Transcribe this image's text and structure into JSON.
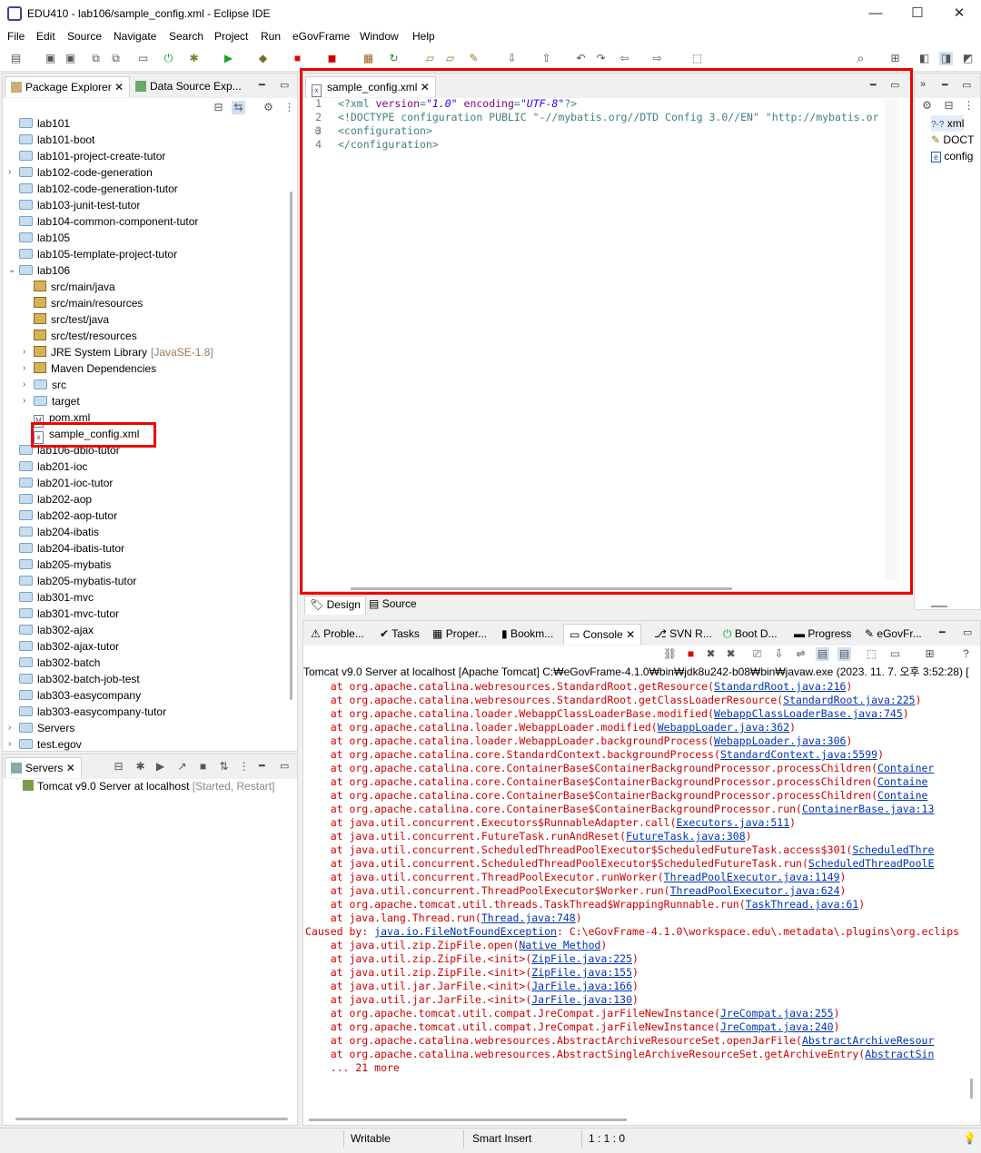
{
  "window": {
    "title": "EDU410 - lab106/sample_config.xml - Eclipse IDE",
    "minimize": "—",
    "maximize": "☐",
    "close": "✕"
  },
  "menu": [
    "File",
    "Edit",
    "Source",
    "Navigate",
    "Search",
    "Project",
    "Run",
    "eGovFrame",
    "Window",
    "Help"
  ],
  "left_tabs": {
    "package_explorer": "Package Explorer",
    "data_source": "Data Source Exp..."
  },
  "tree": [
    {
      "label": "lab101",
      "level": 0,
      "icon": "folder",
      "arrow": ""
    },
    {
      "label": "lab101-boot",
      "level": 0,
      "icon": "folder",
      "arrow": ""
    },
    {
      "label": "lab101-project-create-tutor",
      "level": 0,
      "icon": "folder",
      "arrow": ""
    },
    {
      "label": "lab102-code-generation",
      "level": 0,
      "icon": "folder",
      "arrow": ">"
    },
    {
      "label": "lab102-code-generation-tutor",
      "level": 0,
      "icon": "folder",
      "arrow": ""
    },
    {
      "label": "lab103-junit-test-tutor",
      "level": 0,
      "icon": "folder",
      "arrow": ""
    },
    {
      "label": "lab104-common-component-tutor",
      "level": 0,
      "icon": "folder",
      "arrow": ""
    },
    {
      "label": "lab105",
      "level": 0,
      "icon": "folder",
      "arrow": ""
    },
    {
      "label": "lab105-template-project-tutor",
      "level": 0,
      "icon": "folder",
      "arrow": ""
    },
    {
      "label": "lab106",
      "level": 0,
      "icon": "folder",
      "arrow": "v"
    },
    {
      "label": "src/main/java",
      "level": 1,
      "icon": "pkg",
      "arrow": ""
    },
    {
      "label": "src/main/resources",
      "level": 1,
      "icon": "pkg",
      "arrow": ""
    },
    {
      "label": "src/test/java",
      "level": 1,
      "icon": "pkg",
      "arrow": ""
    },
    {
      "label": "src/test/resources",
      "level": 1,
      "icon": "pkg",
      "arrow": ""
    },
    {
      "label": "JRE System Library",
      "deco": "[JavaSE-1.8]",
      "level": 1,
      "icon": "pkg",
      "arrow": ">"
    },
    {
      "label": "Maven Dependencies",
      "level": 1,
      "icon": "pkg",
      "arrow": ">"
    },
    {
      "label": "src",
      "level": 1,
      "icon": "folder",
      "arrow": ">"
    },
    {
      "label": "target",
      "level": 1,
      "icon": "folder",
      "arrow": ">"
    },
    {
      "label": "pom.xml",
      "level": 1,
      "icon": "xml",
      "arrow": ""
    },
    {
      "label": "sample_config.xml",
      "level": 1,
      "icon": "xml",
      "arrow": ""
    },
    {
      "label": "lab106-dbio-tutor",
      "level": 0,
      "icon": "folder",
      "arrow": ""
    },
    {
      "label": "lab201-ioc",
      "level": 0,
      "icon": "folder",
      "arrow": ""
    },
    {
      "label": "lab201-ioc-tutor",
      "level": 0,
      "icon": "folder",
      "arrow": ""
    },
    {
      "label": "lab202-aop",
      "level": 0,
      "icon": "folder",
      "arrow": ""
    },
    {
      "label": "lab202-aop-tutor",
      "level": 0,
      "icon": "folder",
      "arrow": ""
    },
    {
      "label": "lab204-ibatis",
      "level": 0,
      "icon": "folder",
      "arrow": ""
    },
    {
      "label": "lab204-ibatis-tutor",
      "level": 0,
      "icon": "folder",
      "arrow": ""
    },
    {
      "label": "lab205-mybatis",
      "level": 0,
      "icon": "folder",
      "arrow": ""
    },
    {
      "label": "lab205-mybatis-tutor",
      "level": 0,
      "icon": "folder",
      "arrow": ""
    },
    {
      "label": "lab301-mvc",
      "level": 0,
      "icon": "folder",
      "arrow": ""
    },
    {
      "label": "lab301-mvc-tutor",
      "level": 0,
      "icon": "folder",
      "arrow": ""
    },
    {
      "label": "lab302-ajax",
      "level": 0,
      "icon": "folder",
      "arrow": ""
    },
    {
      "label": "lab302-ajax-tutor",
      "level": 0,
      "icon": "folder",
      "arrow": ""
    },
    {
      "label": "lab302-batch",
      "level": 0,
      "icon": "folder",
      "arrow": ""
    },
    {
      "label": "lab302-batch-job-test",
      "level": 0,
      "icon": "folder",
      "arrow": ""
    },
    {
      "label": "lab303-easycompany",
      "level": 0,
      "icon": "folder",
      "arrow": ""
    },
    {
      "label": "lab303-easycompany-tutor",
      "level": 0,
      "icon": "folder",
      "arrow": ""
    },
    {
      "label": "Servers",
      "level": 0,
      "icon": "folder",
      "arrow": ">"
    },
    {
      "label": "test.egov",
      "level": 0,
      "icon": "folder",
      "arrow": ">"
    }
  ],
  "servers": {
    "tab": "Servers",
    "item": "Tomcat v9.0 Server at localhost",
    "status": "[Started, Restart]"
  },
  "editor": {
    "tab": "sample_config.xml",
    "line_numbers": [
      "1",
      "2",
      "3",
      "4"
    ],
    "lines": [
      {
        "parts": [
          [
            "pi",
            "<?xml "
          ],
          [
            "attr",
            "version"
          ],
          [
            "pi",
            "="
          ],
          [
            "str",
            "\"1.0\""
          ],
          [
            "pi",
            " "
          ],
          [
            "attr",
            "encoding"
          ],
          [
            "pi",
            "="
          ],
          [
            "str",
            "\"UTF-8\""
          ],
          [
            "pi",
            "?>"
          ]
        ]
      },
      {
        "parts": [
          [
            "pi",
            "<!DOCTYPE configuration PUBLIC \"-//mybatis.org//DTD Config 3.0//EN\" \"http://mybatis.or"
          ]
        ]
      },
      {
        "parts": [
          [
            "tag",
            "<configuration>"
          ]
        ]
      },
      {
        "parts": [
          [
            "tag",
            "</configuration>"
          ]
        ]
      }
    ],
    "bottom_tabs": [
      "Design",
      "Source"
    ]
  },
  "outline": {
    "items": [
      "xml",
      "DOCT",
      "config"
    ]
  },
  "bottom_tabs": [
    "Proble...",
    "Tasks",
    "Proper...",
    "Bookm...",
    "Console",
    "SVN R...",
    "Boot D...",
    "Progress",
    "eGovFr..."
  ],
  "console": {
    "header": "Tomcat v9.0 Server at localhost [Apache Tomcat] C:₩eGovFrame-4.1.0₩bin₩jdk8u242-b08₩bin₩javaw.exe  (2023. 11. 7. 오후 3:52:28) [",
    "lines": [
      [
        "    at org.apache.catalina.webresources.StandardRoot.getResource(",
        "StandardRoot.java:216",
        ")"
      ],
      [
        "    at org.apache.catalina.webresources.StandardRoot.getClassLoaderResource(",
        "StandardRoot.java:225",
        ")"
      ],
      [
        "    at org.apache.catalina.loader.WebappClassLoaderBase.modified(",
        "WebappClassLoaderBase.java:745",
        ")"
      ],
      [
        "    at org.apache.catalina.loader.WebappLoader.modified(",
        "WebappLoader.java:362",
        ")"
      ],
      [
        "    at org.apache.catalina.loader.WebappLoader.backgroundProcess(",
        "WebappLoader.java:306",
        ")"
      ],
      [
        "    at org.apache.catalina.core.StandardContext.backgroundProcess(",
        "StandardContext.java:5599",
        ")"
      ],
      [
        "    at org.apache.catalina.core.ContainerBase$ContainerBackgroundProcessor.processChildren(",
        "Container",
        ""
      ],
      [
        "    at org.apache.catalina.core.ContainerBase$ContainerBackgroundProcessor.processChildren(",
        "Containe",
        ""
      ],
      [
        "    at org.apache.catalina.core.ContainerBase$ContainerBackgroundProcessor.processChildren(",
        "Containe",
        ""
      ],
      [
        "    at org.apache.catalina.core.ContainerBase$ContainerBackgroundProcessor.run(",
        "ContainerBase.java:13",
        ""
      ],
      [
        "    at java.util.concurrent.Executors$RunnableAdapter.call(",
        "Executors.java:511",
        ")"
      ],
      [
        "    at java.util.concurrent.FutureTask.runAndReset(",
        "FutureTask.java:308",
        ")"
      ],
      [
        "    at java.util.concurrent.ScheduledThreadPoolExecutor$ScheduledFutureTask.access$301(",
        "ScheduledThre",
        ""
      ],
      [
        "    at java.util.concurrent.ScheduledThreadPoolExecutor$ScheduledFutureTask.run(",
        "ScheduledThreadPoolE",
        ""
      ],
      [
        "    at java.util.concurrent.ThreadPoolExecutor.runWorker(",
        "ThreadPoolExecutor.java:1149",
        ")"
      ],
      [
        "    at java.util.concurrent.ThreadPoolExecutor$Worker.run(",
        "ThreadPoolExecutor.java:624",
        ")"
      ],
      [
        "    at org.apache.tomcat.util.threads.TaskThread$WrappingRunnable.run(",
        "TaskThread.java:61",
        ")"
      ],
      [
        "    at java.lang.Thread.run(",
        "Thread.java:748",
        ")"
      ],
      [
        "Caused by: ",
        "java.io.FileNotFoundException",
        ": C:\\eGovFrame-4.1.0\\workspace.edu\\.metadata\\.plugins\\org.eclips"
      ],
      [
        "    at java.util.zip.ZipFile.open(",
        "Native Method",
        ")"
      ],
      [
        "    at java.util.zip.ZipFile.<init>(",
        "ZipFile.java:225",
        ")"
      ],
      [
        "    at java.util.zip.ZipFile.<init>(",
        "ZipFile.java:155",
        ")"
      ],
      [
        "    at java.util.jar.JarFile.<init>(",
        "JarFile.java:166",
        ")"
      ],
      [
        "    at java.util.jar.JarFile.<init>(",
        "JarFile.java:130",
        ")"
      ],
      [
        "    at org.apache.tomcat.util.compat.JreCompat.jarFileNewInstance(",
        "JreCompat.java:255",
        ")"
      ],
      [
        "    at org.apache.tomcat.util.compat.JreCompat.jarFileNewInstance(",
        "JreCompat.java:240",
        ")"
      ],
      [
        "    at org.apache.catalina.webresources.AbstractArchiveResourceSet.openJarFile(",
        "AbstractArchiveResour",
        ""
      ],
      [
        "    at org.apache.catalina.webresources.AbstractSingleArchiveResourceSet.getArchiveEntry(",
        "AbstractSin",
        ""
      ],
      [
        "    ... 21 more",
        "",
        ""
      ]
    ]
  },
  "status": {
    "writable": "Writable",
    "insert": "Smart Insert",
    "position": "1 : 1 : 0"
  },
  "colors": {
    "highlight": "#e00000",
    "error": "#cc0000",
    "link": "#0033b3"
  }
}
